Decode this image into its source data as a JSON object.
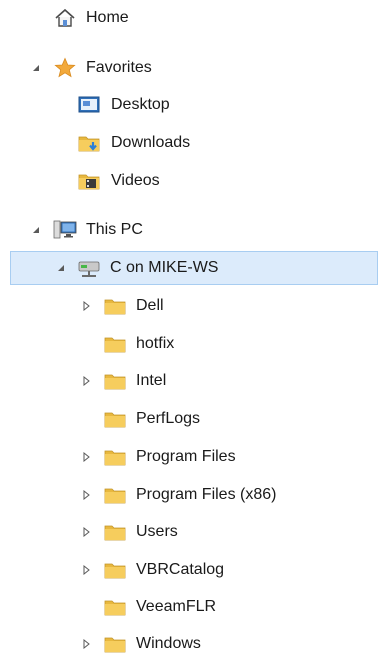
{
  "tree": {
    "items": [
      {
        "label": "Home",
        "icon": "home-icon",
        "expander": "none",
        "selected": false
      },
      {
        "label": "Favorites",
        "icon": "star-icon",
        "expander": "expanded",
        "selected": false
      },
      {
        "label": "Desktop",
        "icon": "desktop-icon",
        "expander": "none",
        "selected": false
      },
      {
        "label": "Downloads",
        "icon": "downloads-folder-icon",
        "expander": "none",
        "selected": false
      },
      {
        "label": "Videos",
        "icon": "videos-folder-icon",
        "expander": "none",
        "selected": false
      },
      {
        "label": "This PC",
        "icon": "computer-icon",
        "expander": "expanded",
        "selected": false
      },
      {
        "label": "C on MIKE-WS",
        "icon": "network-drive-icon",
        "expander": "expanded",
        "selected": true
      },
      {
        "label": "Dell",
        "icon": "folder-icon",
        "expander": "collapsed",
        "selected": false
      },
      {
        "label": "hotfix",
        "icon": "folder-icon",
        "expander": "none",
        "selected": false
      },
      {
        "label": "Intel",
        "icon": "folder-icon",
        "expander": "collapsed",
        "selected": false
      },
      {
        "label": "PerfLogs",
        "icon": "folder-icon",
        "expander": "none",
        "selected": false
      },
      {
        "label": "Program Files",
        "icon": "folder-icon",
        "expander": "collapsed",
        "selected": false
      },
      {
        "label": "Program Files (x86)",
        "icon": "folder-icon",
        "expander": "collapsed",
        "selected": false
      },
      {
        "label": "Users",
        "icon": "folder-icon",
        "expander": "collapsed",
        "selected": false
      },
      {
        "label": "VBRCatalog",
        "icon": "folder-icon",
        "expander": "collapsed",
        "selected": false
      },
      {
        "label": "VeeamFLR",
        "icon": "folder-icon",
        "expander": "none",
        "selected": false
      },
      {
        "label": "Windows",
        "icon": "folder-icon",
        "expander": "collapsed",
        "selected": false
      }
    ]
  },
  "colors": {
    "selection_bg": "#dcebfb",
    "selection_border": "#a8cdf1",
    "folder": "#e8b83f",
    "star": "#f2a93b"
  }
}
